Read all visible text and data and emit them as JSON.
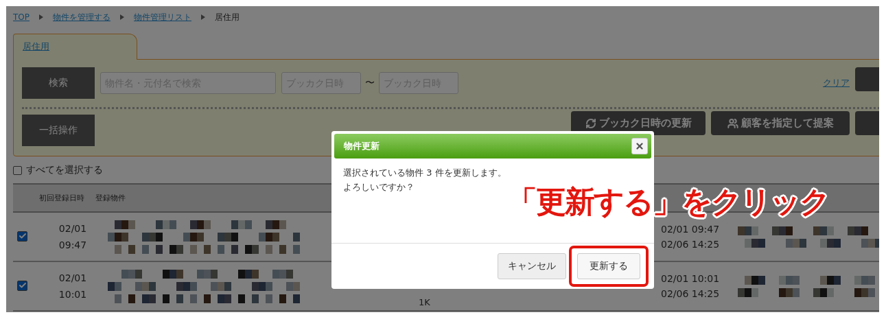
{
  "breadcrumb": [
    {
      "label": "TOP",
      "link": true
    },
    {
      "label": "物件を管理する",
      "link": true
    },
    {
      "label": "物件管理リスト",
      "link": true
    },
    {
      "label": "居住用",
      "link": false
    }
  ],
  "tab": {
    "label": "居住用"
  },
  "search": {
    "button": "検索",
    "keyword_placeholder": "物件名・元付名で検索",
    "date_from_placeholder": "ブッカク日時",
    "range_separator": "〜",
    "date_to_placeholder": "ブッカク日時",
    "clear": "クリア"
  },
  "bulk": {
    "button": "一括操作",
    "actions": [
      {
        "label": "ブッカク日時の更新"
      },
      {
        "label": "顧客を指定して提案"
      }
    ]
  },
  "select_all": {
    "label": "すべてを選択する",
    "checked": false
  },
  "table": {
    "columns": [
      "初回登録日時",
      "登録物件"
    ],
    "rows": [
      {
        "checked": true,
        "registered": [
          "02/01",
          "09:47"
        ],
        "booking": [
          "02/01 09:47",
          "02/06 14:25"
        ]
      },
      {
        "checked": true,
        "registered": [
          "02/01",
          "10:01"
        ],
        "column_3": "1K",
        "booking": [
          "02/01 10:01",
          "02/06 14:25"
        ]
      }
    ]
  },
  "dialog": {
    "title": "物件更新",
    "message": [
      "選択されている物件 3 件を更新します。",
      "よろしいですか？"
    ],
    "buttons": [
      {
        "label": "キャンセル",
        "kind": "cancel",
        "highlighted": false
      },
      {
        "label": "更新する",
        "kind": "confirm",
        "highlighted": true
      }
    ]
  },
  "annotation": "「更新する」をクリック"
}
